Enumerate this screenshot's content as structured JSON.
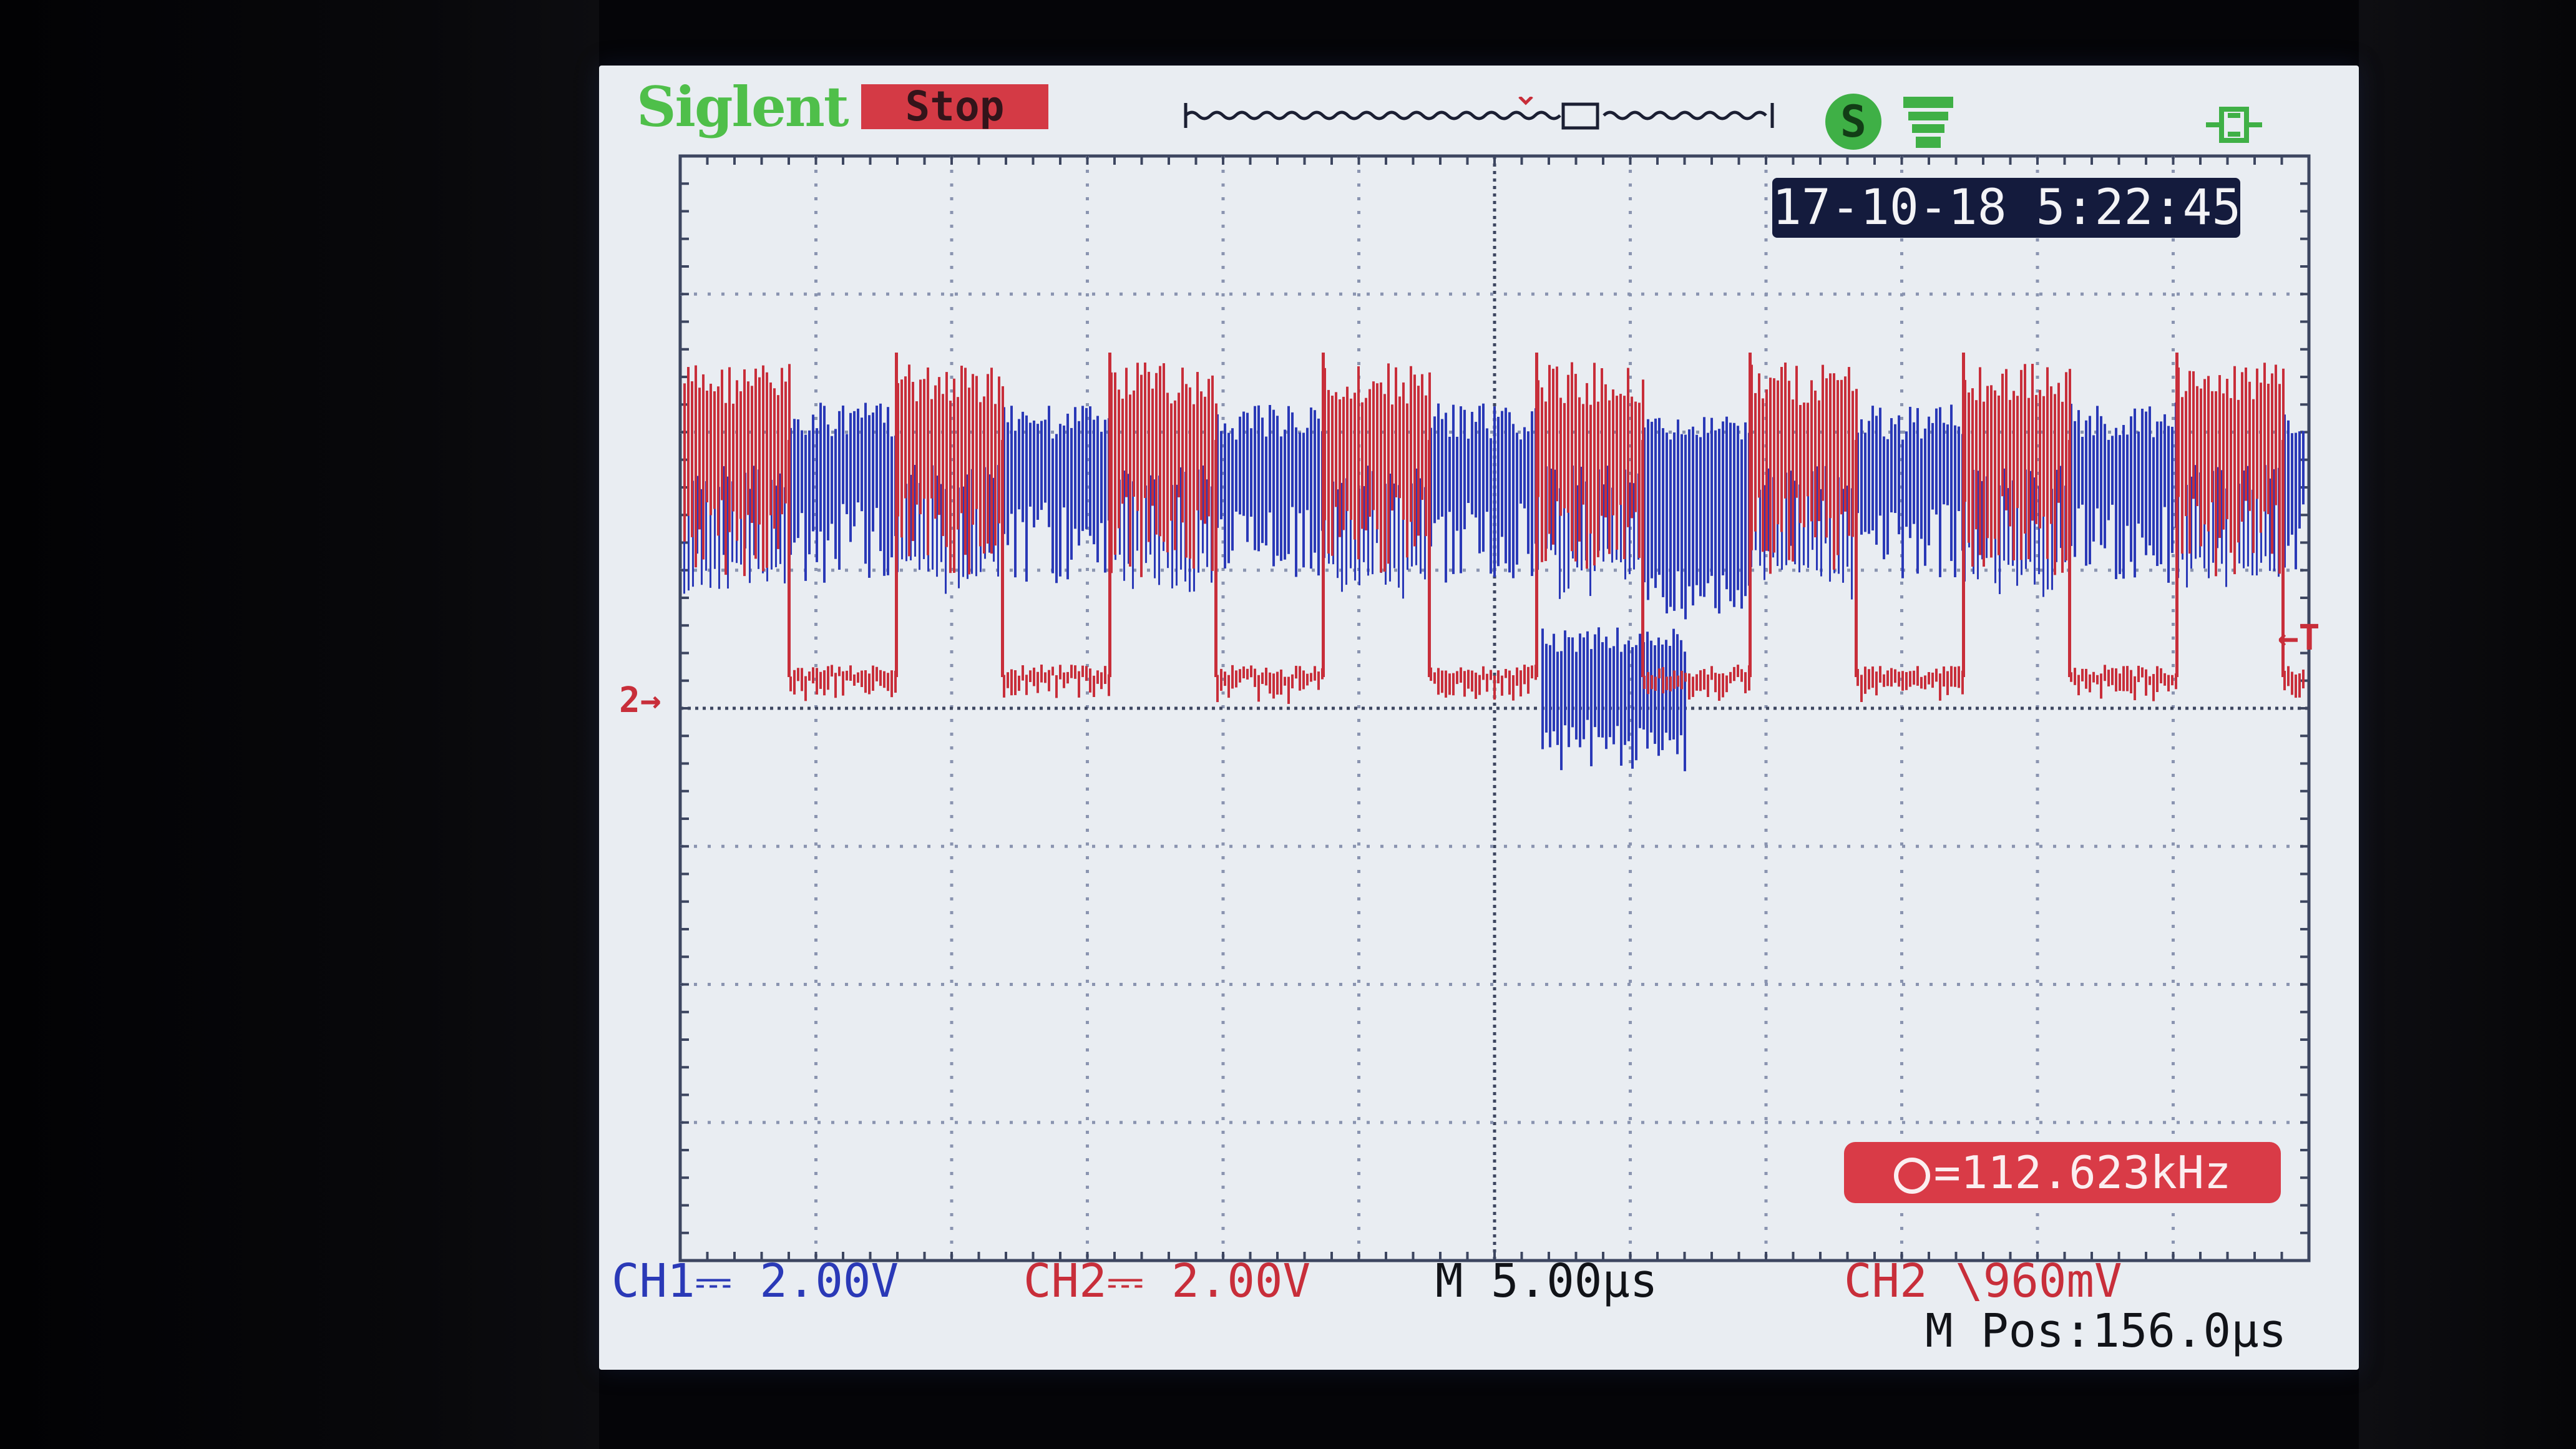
{
  "brand": "Siglent",
  "run_state": "Stop",
  "datetime": "17-10-18 5:22:45",
  "measurement": {
    "icon": "frequency-icon",
    "text": "=112.623kHz"
  },
  "ch1": {
    "label": "CH1",
    "coupling_symbol": "⎓",
    "scale": "2.00V",
    "color": "#2a39b7"
  },
  "ch2": {
    "label": "CH2",
    "coupling_symbol": "⎓",
    "scale": "2.00V",
    "color": "#c82e3a"
  },
  "timebase": {
    "scale": "M 5.00μs",
    "position": "M Pos:156.0μs"
  },
  "trigger": {
    "source": "CH2",
    "slope_symbol": "\\",
    "level": "960mV"
  },
  "markers": {
    "ch2_marker": "2→",
    "trigger_marker": "←T"
  },
  "icons": [
    "run-state-icon",
    "usb-icon",
    "power-icon"
  ],
  "colors": {
    "screen_bg": "#e9edf2",
    "grid_dot": "#8a94b0",
    "ch1": "#2a39b7",
    "ch2": "#c82e3a",
    "brand": "#4fbf4a"
  }
}
